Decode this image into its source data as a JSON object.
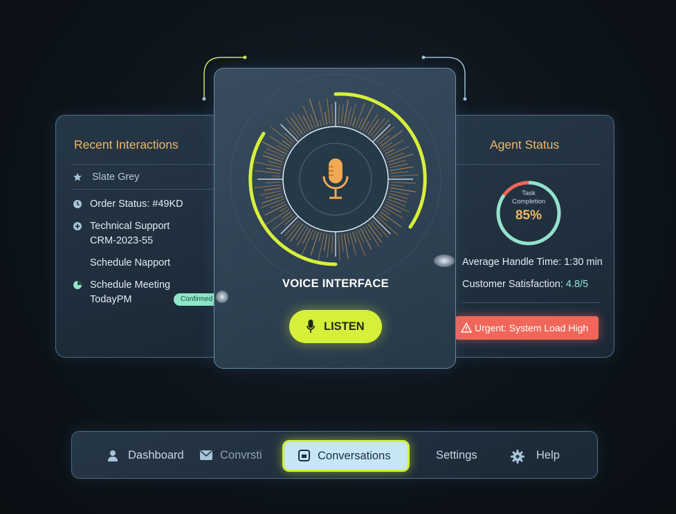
{
  "left_panel": {
    "title": "Recent Interactions",
    "items": [
      {
        "icon": "star-icon",
        "text": "Slate Grey"
      },
      {
        "icon": "clock-icon",
        "text": "Order Status: #49KD"
      },
      {
        "icon": "plus-circle-icon",
        "text": "Technical Support",
        "text2": "CRM-2023-55"
      },
      {
        "icon": "",
        "text": "Schedule Napport"
      },
      {
        "icon": "pie-icon",
        "text": "Schedule Meeting",
        "text2": "TodayPM"
      }
    ],
    "badge": "Confirmed"
  },
  "center_panel": {
    "icon": "microphone-icon",
    "title": "VOICE INTERFACE",
    "listen_label": "LISTEN"
  },
  "right_panel": {
    "title": "Agent Status",
    "gauge": {
      "label_line1": "Task",
      "label_line2": "Completion",
      "value_text": "85%",
      "value": 0.85
    },
    "stats": [
      {
        "label": "Average Handle Time:",
        "value": "1:30 min"
      },
      {
        "label": "Customer Satisfaction:",
        "value": "4.8/5"
      }
    ],
    "alert": "Urgent: System Load High"
  },
  "bottom_nav": {
    "items": [
      {
        "icon": "user-icon",
        "label": "Dashboard"
      },
      {
        "icon": "mail-icon",
        "label": "Convrsti"
      },
      {
        "icon": "inbox-icon",
        "label": "Conversations",
        "active": true
      },
      {
        "icon": "",
        "label": "Settings"
      },
      {
        "icon": "gear-icon",
        "label": "Help"
      }
    ]
  },
  "colors": {
    "accent_lime": "#d6f03a",
    "title_orange": "#f0b86a",
    "alert_red": "#f0675a",
    "teal": "#8fe3cf"
  }
}
